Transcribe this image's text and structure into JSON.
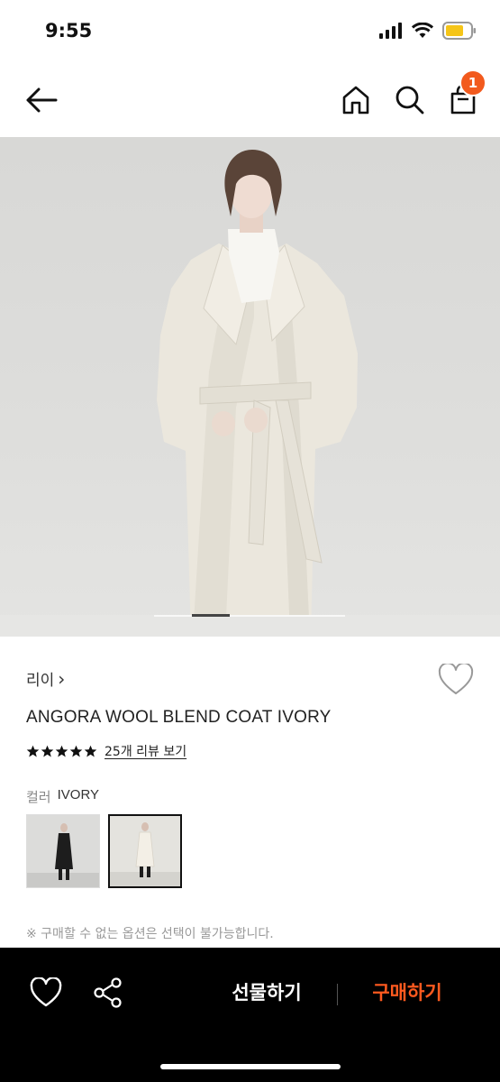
{
  "status": {
    "time": "9:55"
  },
  "nav": {
    "cart_count": "1"
  },
  "product": {
    "brand": "리이",
    "brand_chevron": "›",
    "name": "ANGORA WOOL BLEND COAT IVORY",
    "rating_stars": 5,
    "review_link": "25개 리뷰 보기",
    "color_label": "컬러",
    "color_value": "IVORY",
    "notice": "※ 구매할 수 없는 옵션은 선택이 불가능합니다."
  },
  "gallery": {
    "active_index": 2
  },
  "actions": {
    "gift_label": "선물하기",
    "buy_label": "구매하기"
  },
  "colors": {
    "badge": "#f25a1d",
    "buy": "#ff5a1f",
    "bottom_bar": "#000000"
  },
  "icons": [
    "back-arrow-icon",
    "home-icon",
    "search-icon",
    "shopping-bag-icon",
    "heart-icon",
    "share-icon",
    "star-icon",
    "chevron-right-icon"
  ]
}
